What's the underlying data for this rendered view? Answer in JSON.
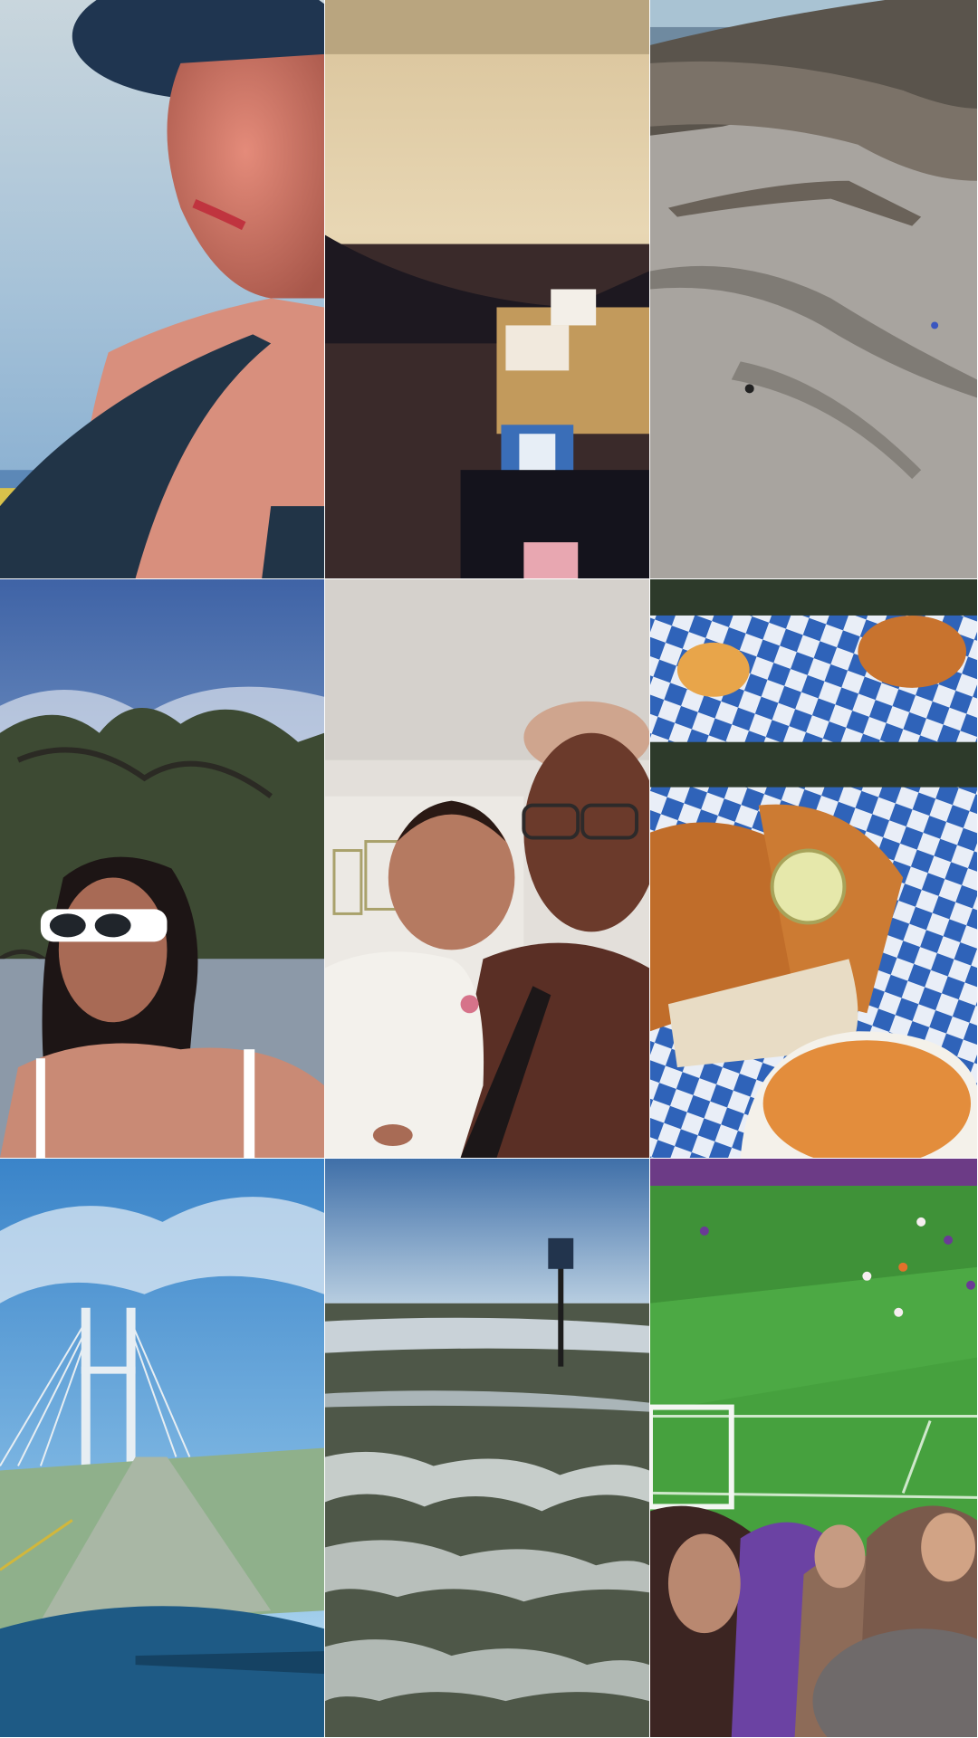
{
  "grid": {
    "rows": 3,
    "columns": 3,
    "tiles": [
      {
        "name": "tile-lake-selfie-hat"
      },
      {
        "name": "tile-blurred-backpack"
      },
      {
        "name": "tile-driftwood-beach"
      },
      {
        "name": "tile-tree-sunglasses-selfie"
      },
      {
        "name": "tile-mother-baby-selfie"
      },
      {
        "name": "tile-fried-chicken-plate"
      },
      {
        "name": "tile-cable-bridge-drive"
      },
      {
        "name": "tile-ocean-waves-sign"
      },
      {
        "name": "tile-soccer-stadium"
      }
    ]
  }
}
